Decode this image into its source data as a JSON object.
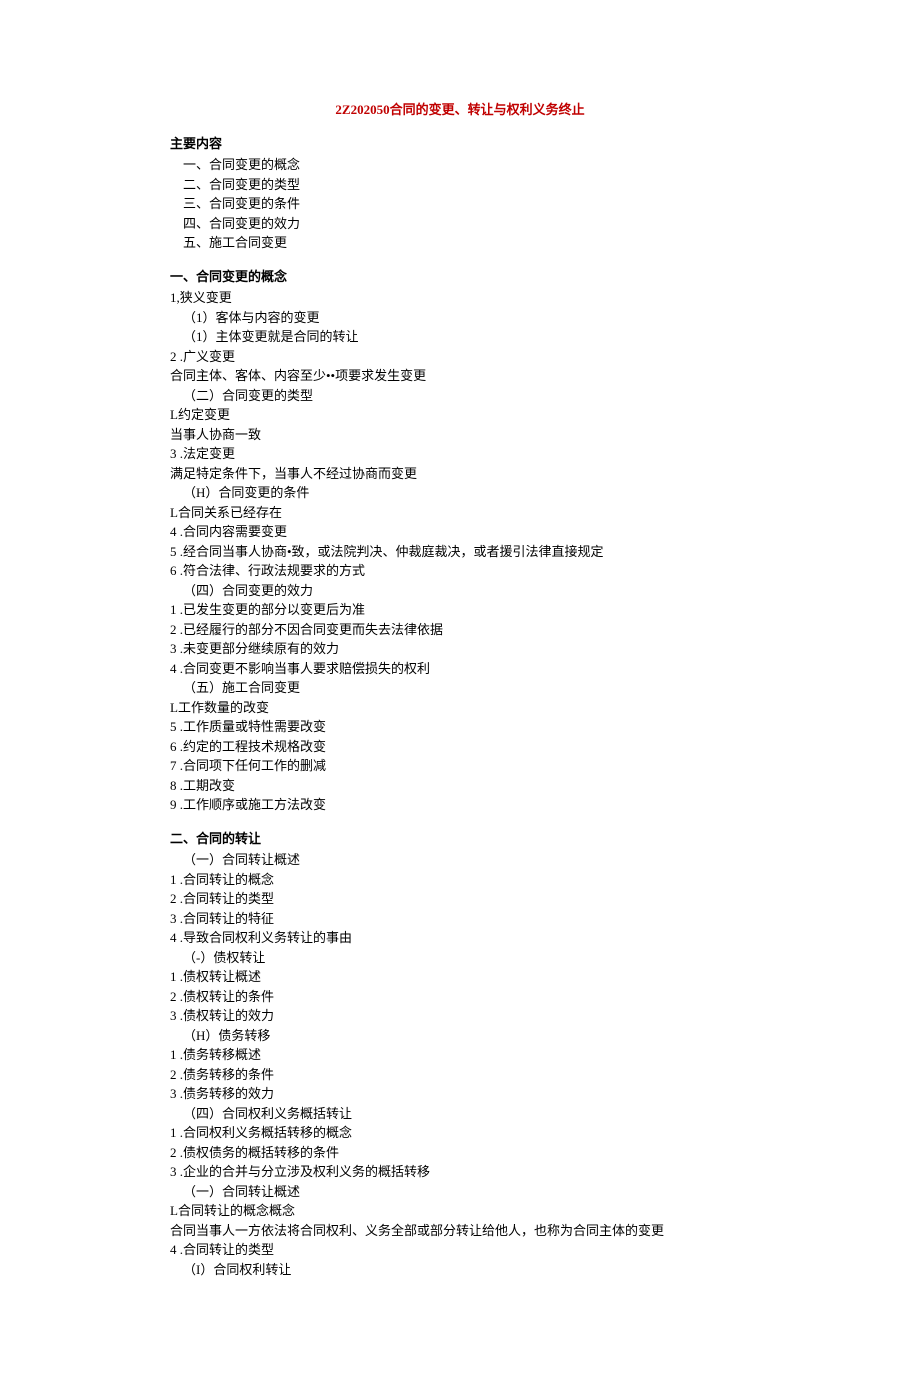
{
  "title": "2Z202050合同的变更、转让与权利义务终止",
  "mainHeader": "主要内容",
  "mainContents": [
    "一、合同变更的概念",
    "二、合同变更的类型",
    "三、合同变更的条件",
    "四、合同变更的效力",
    "五、施工合同变更"
  ],
  "section1": {
    "header": "一、合同变更的概念",
    "lines": [
      "1,狭义变更",
      "（1）客体与内容的变更",
      "（1）主体变更就是合同的转让",
      "2 .广义变更",
      "合同主体、客体、内容至少••项要求发生变更",
      "（二）合同变更的类型",
      "L约定变更",
      "当事人协商一致",
      "3 .法定变更",
      "满足特定条件下，当事人不经过协商而变更",
      "（H）合同变更的条件",
      "L合同关系已经存在",
      "4 .合同内容需要变更",
      "5 .经合同当事人协商•致，或法院判决、仲裁庭裁决，或者援引法律直接规定",
      "6 .符合法律、行政法规要求的方式",
      "（四）合同变更的效力",
      "1 .已发生变更的部分以变更后为准",
      "2 .已经履行的部分不因合同变更而失去法律依据",
      "3 .未变更部分继续原有的效力",
      "4 .合同变更不影响当事人要求赔偿损失的权利",
      "（五）施工合同变更",
      "L工作数量的改变",
      "5 .工作质量或特性需要改变",
      "6 .约定的工程技术规格改变",
      "7 .合同项下任何工作的删减",
      "8 .工期改变",
      "9 .工作顺序或施工方法改变"
    ]
  },
  "section2": {
    "header": "二、合同的转让",
    "lines": [
      "（一）合同转让概述",
      "1 .合同转让的概念",
      "2 .合同转让的类型",
      "3 .合同转让的特征",
      "4 .导致合同权利义务转让的事由",
      "（-）债权转让",
      "1 .债权转让概述",
      "2 .债权转让的条件",
      "3 .债权转让的效力",
      "（H）债务转移",
      "1 .债务转移概述",
      "2 .债务转移的条件",
      "3 .债务转移的效力",
      "（四）合同权利义务概括转让",
      "1 .合同权利义务概括转移的概念",
      "2 .债权债务的概括转移的条件",
      "3 .企业的合并与分立涉及权利义务的概括转移",
      "（一）合同转让概述",
      "L合同转让的概念概念",
      "合同当事人一方依法将合同权利、义务全部或部分转让给他人，也称为合同主体的变更",
      "4 .合同转让的类型",
      "（I）合同权利转让"
    ]
  }
}
